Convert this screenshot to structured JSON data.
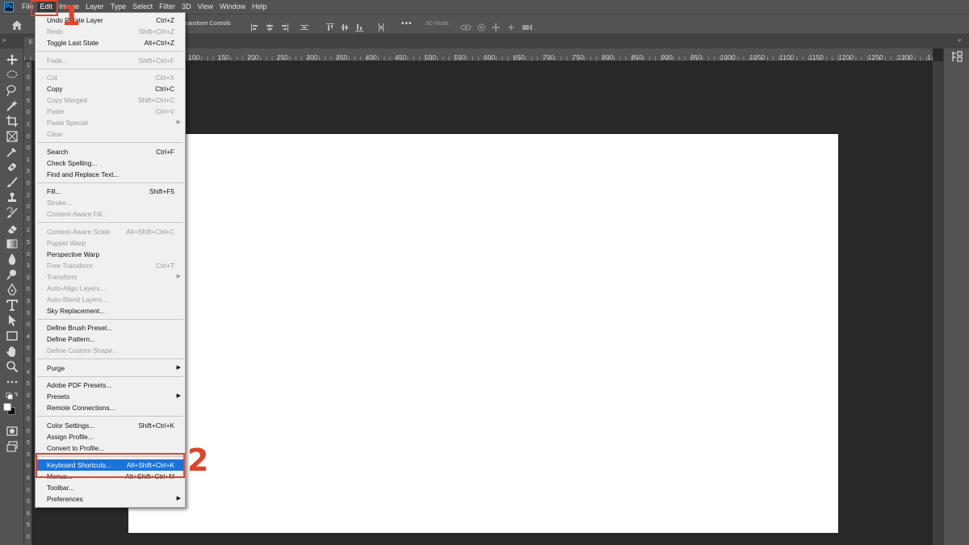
{
  "app": {
    "logo_text": "Ps"
  },
  "menubar": {
    "items": [
      {
        "label": "File",
        "active": false
      },
      {
        "label": "Edit",
        "active": true
      },
      {
        "label": "Image",
        "active": false
      },
      {
        "label": "Layer",
        "active": false
      },
      {
        "label": "Type",
        "active": false
      },
      {
        "label": "Select",
        "active": false
      },
      {
        "label": "Filter",
        "active": false
      },
      {
        "label": "3D",
        "active": false
      },
      {
        "label": "View",
        "active": false
      },
      {
        "label": "Window",
        "active": false
      },
      {
        "label": "Help",
        "active": false
      }
    ]
  },
  "options": {
    "transform_controls_label": "ransform Controls",
    "mode_label": "3D Mode:",
    "more_glyph": "•••"
  },
  "doc_tab": {
    "label": "F"
  },
  "ruler": {
    "top_ticks": [
      "100",
      "150",
      "200",
      "250",
      "300",
      "350",
      "400",
      "450",
      "500",
      "550",
      "600",
      "650",
      "700",
      "750",
      "800",
      "850",
      "900",
      "950",
      "1000",
      "1050",
      "1100",
      "1150",
      "1200",
      "1250",
      "1300",
      "1"
    ],
    "left_ticks": [
      "1",
      "0",
      "0",
      "5",
      "0",
      "1",
      "0",
      "0",
      "1",
      "5",
      "0",
      "2",
      "0",
      "0",
      "2",
      "5",
      "0",
      "3",
      "0",
      "0",
      "3",
      "5",
      "0",
      "4",
      "0",
      "0",
      "4",
      "5",
      "0",
      "5",
      "0",
      "0",
      "5",
      "5",
      "0",
      "6",
      "0",
      "0",
      "6",
      "5",
      "0"
    ]
  },
  "edit_menu": {
    "items": [
      {
        "label": "Undo Rotate Layer",
        "shortcut": "Ctrl+Z",
        "disabled": false
      },
      {
        "label": "Redo",
        "shortcut": "Shift+Ctrl+Z",
        "disabled": true
      },
      {
        "label": "Toggle Last State",
        "shortcut": "Alt+Ctrl+Z",
        "disabled": false
      },
      {
        "sep": true
      },
      {
        "label": "Fade...",
        "shortcut": "Shift+Ctrl+F",
        "disabled": true
      },
      {
        "sep": true
      },
      {
        "label": "Cut",
        "shortcut": "Ctrl+X",
        "disabled": true
      },
      {
        "label": "Copy",
        "shortcut": "Ctrl+C",
        "disabled": false
      },
      {
        "label": "Copy Merged",
        "shortcut": "Shift+Ctrl+C",
        "disabled": true
      },
      {
        "label": "Paste",
        "shortcut": "Ctrl+V",
        "disabled": true
      },
      {
        "label": "Paste Special",
        "shortcut": "",
        "disabled": true,
        "submenu": true
      },
      {
        "label": "Clear",
        "shortcut": "",
        "disabled": true
      },
      {
        "sep": true
      },
      {
        "label": "Search",
        "shortcut": "Ctrl+F",
        "disabled": false
      },
      {
        "label": "Check Spelling...",
        "shortcut": "",
        "disabled": false
      },
      {
        "label": "Find and Replace Text...",
        "shortcut": "",
        "disabled": false
      },
      {
        "sep": true
      },
      {
        "label": "Fill...",
        "shortcut": "Shift+F5",
        "disabled": false
      },
      {
        "label": "Stroke...",
        "shortcut": "",
        "disabled": true
      },
      {
        "label": "Content-Aware Fill...",
        "shortcut": "",
        "disabled": true
      },
      {
        "sep": true
      },
      {
        "label": "Content-Aware Scale",
        "shortcut": "Alt+Shift+Ctrl+C",
        "disabled": true
      },
      {
        "label": "Puppet Warp",
        "shortcut": "",
        "disabled": true
      },
      {
        "label": "Perspective Warp",
        "shortcut": "",
        "disabled": false
      },
      {
        "label": "Free Transform",
        "shortcut": "Ctrl+T",
        "disabled": true
      },
      {
        "label": "Transform",
        "shortcut": "",
        "disabled": true,
        "submenu": true
      },
      {
        "label": "Auto-Align Layers...",
        "shortcut": "",
        "disabled": true
      },
      {
        "label": "Auto-Blend Layers...",
        "shortcut": "",
        "disabled": true
      },
      {
        "label": "Sky Replacement...",
        "shortcut": "",
        "disabled": false
      },
      {
        "sep": true
      },
      {
        "label": "Define Brush Preset...",
        "shortcut": "",
        "disabled": false
      },
      {
        "label": "Define Pattern...",
        "shortcut": "",
        "disabled": false
      },
      {
        "label": "Define Custom Shape...",
        "shortcut": "",
        "disabled": true
      },
      {
        "sep": true
      },
      {
        "label": "Purge",
        "shortcut": "",
        "disabled": false,
        "submenu": true
      },
      {
        "sep": true
      },
      {
        "label": "Adobe PDF Presets...",
        "shortcut": "",
        "disabled": false
      },
      {
        "label": "Presets",
        "shortcut": "",
        "disabled": false,
        "submenu": true
      },
      {
        "label": "Remote Connections...",
        "shortcut": "",
        "disabled": false
      },
      {
        "sep": true
      },
      {
        "label": "Color Settings...",
        "shortcut": "Shift+Ctrl+K",
        "disabled": false
      },
      {
        "label": "Assign Profile...",
        "shortcut": "",
        "disabled": false
      },
      {
        "label": "Convert to Profile...",
        "shortcut": "",
        "disabled": false
      },
      {
        "sep": true
      },
      {
        "label": "Keyboard Shortcuts...",
        "shortcut": "Alt+Shift+Ctrl+K",
        "disabled": false,
        "highlight": true
      },
      {
        "label": "Menus...",
        "shortcut": "Alt+Shift+Ctrl+M",
        "disabled": false
      },
      {
        "label": "Toolbar...",
        "shortcut": "",
        "disabled": false
      },
      {
        "label": "Preferences",
        "shortcut": "",
        "disabled": false,
        "submenu": true
      }
    ]
  },
  "annotations": {
    "step1": "1",
    "step2": "2"
  },
  "colors": {
    "highlight": "#1a73d9",
    "annotation": "#e0442a",
    "panel": "#535353",
    "workspace": "#282828"
  },
  "icons": {
    "toolbar": [
      "move-icon",
      "lasso-icon",
      "quick-select-icon",
      "magic-wand-icon",
      "crop-icon",
      "frame-icon",
      "eyedropper-icon",
      "healing-brush-icon",
      "brush-icon",
      "clone-stamp-icon",
      "history-brush-icon",
      "eraser-icon",
      "gradient-icon",
      "blur-icon",
      "dodge-icon",
      "pen-icon",
      "type-icon",
      "path-select-icon",
      "rectangle-icon",
      "hand-icon",
      "zoom-icon",
      "more-tools-icon",
      "swap-colors-icon",
      "color-swatch-icon",
      "quick-mask-icon",
      "screen-mode-icon"
    ]
  }
}
